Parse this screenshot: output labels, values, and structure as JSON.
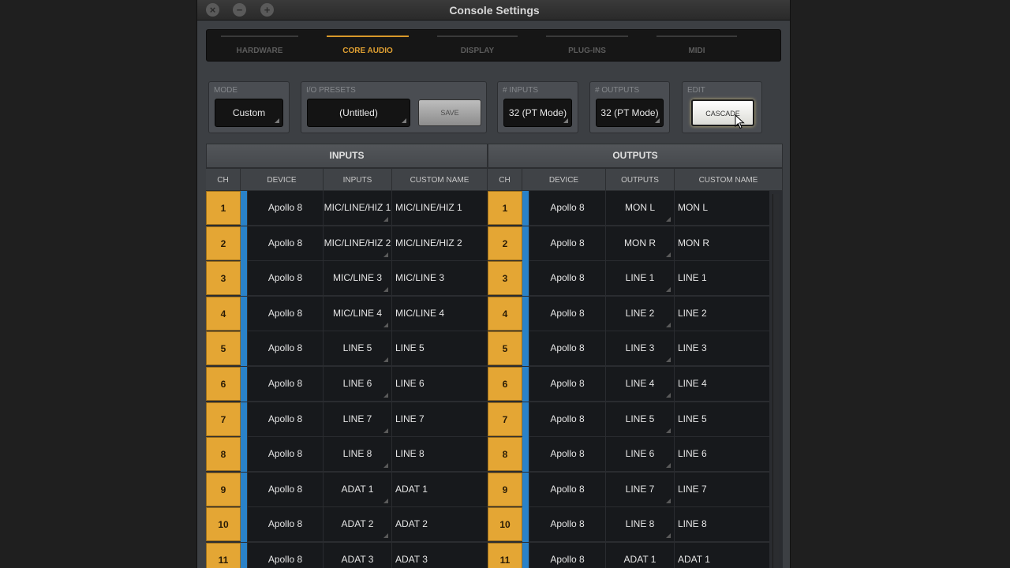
{
  "window": {
    "title": "Console Settings"
  },
  "tabs": [
    {
      "label": "HARDWARE",
      "active": false
    },
    {
      "label": "CORE AUDIO",
      "active": true
    },
    {
      "label": "DISPLAY",
      "active": false
    },
    {
      "label": "PLUG-INS",
      "active": false
    },
    {
      "label": "MIDI",
      "active": false
    }
  ],
  "controls": {
    "mode": {
      "label": "MODE",
      "value": "Custom"
    },
    "io_presets": {
      "label": "I/O PRESETS",
      "value": "(Untitled)",
      "save_label": "SAVE"
    },
    "inputs": {
      "label": "# INPUTS",
      "value": "32 (PT Mode)"
    },
    "outputs": {
      "label": "# OUTPUTS",
      "value": "32 (PT Mode)"
    },
    "edit": {
      "label": "EDIT",
      "cascade_label": "CASCADE"
    }
  },
  "table": {
    "inputs_title": "INPUTS",
    "outputs_title": "OUTPUTS",
    "input_columns": [
      "CH",
      "DEVICE",
      "INPUTS",
      "CUSTOM NAME"
    ],
    "output_columns": [
      "CH",
      "DEVICE",
      "OUTPUTS",
      "CUSTOM NAME"
    ],
    "input_rows": [
      {
        "ch": "1",
        "device": "Apollo 8",
        "io": "MIC/LINE/HIZ 1",
        "name": "MIC/LINE/HIZ 1"
      },
      {
        "ch": "2",
        "device": "Apollo 8",
        "io": "MIC/LINE/HIZ 2",
        "name": "MIC/LINE/HIZ 2"
      },
      {
        "ch": "3",
        "device": "Apollo 8",
        "io": "MIC/LINE 3",
        "name": "MIC/LINE 3"
      },
      {
        "ch": "4",
        "device": "Apollo 8",
        "io": "MIC/LINE 4",
        "name": "MIC/LINE 4"
      },
      {
        "ch": "5",
        "device": "Apollo 8",
        "io": "LINE 5",
        "name": "LINE 5"
      },
      {
        "ch": "6",
        "device": "Apollo 8",
        "io": "LINE 6",
        "name": "LINE 6"
      },
      {
        "ch": "7",
        "device": "Apollo 8",
        "io": "LINE 7",
        "name": "LINE 7"
      },
      {
        "ch": "8",
        "device": "Apollo 8",
        "io": "LINE 8",
        "name": "LINE 8"
      },
      {
        "ch": "9",
        "device": "Apollo 8",
        "io": "ADAT 1",
        "name": "ADAT 1"
      },
      {
        "ch": "10",
        "device": "Apollo 8",
        "io": "ADAT 2",
        "name": "ADAT 2"
      },
      {
        "ch": "11",
        "device": "Apollo 8",
        "io": "ADAT 3",
        "name": "ADAT 3"
      }
    ],
    "output_rows": [
      {
        "ch": "1",
        "device": "Apollo 8",
        "io": "MON L",
        "name": "MON L"
      },
      {
        "ch": "2",
        "device": "Apollo 8",
        "io": "MON R",
        "name": "MON R"
      },
      {
        "ch": "3",
        "device": "Apollo 8",
        "io": "LINE 1",
        "name": "LINE 1"
      },
      {
        "ch": "4",
        "device": "Apollo 8",
        "io": "LINE 2",
        "name": "LINE 2"
      },
      {
        "ch": "5",
        "device": "Apollo 8",
        "io": "LINE 3",
        "name": "LINE 3"
      },
      {
        "ch": "6",
        "device": "Apollo 8",
        "io": "LINE 4",
        "name": "LINE 4"
      },
      {
        "ch": "7",
        "device": "Apollo 8",
        "io": "LINE 5",
        "name": "LINE 5"
      },
      {
        "ch": "8",
        "device": "Apollo 8",
        "io": "LINE 6",
        "name": "LINE 6"
      },
      {
        "ch": "9",
        "device": "Apollo 8",
        "io": "LINE 7",
        "name": "LINE 7"
      },
      {
        "ch": "10",
        "device": "Apollo 8",
        "io": "LINE 8",
        "name": "LINE 8"
      },
      {
        "ch": "11",
        "device": "Apollo 8",
        "io": "ADAT 1",
        "name": "ADAT 1"
      }
    ]
  },
  "colors": {
    "accent": "#e4a634",
    "channel_strip": "#2a82c8",
    "tab_active": "#e0a032"
  }
}
